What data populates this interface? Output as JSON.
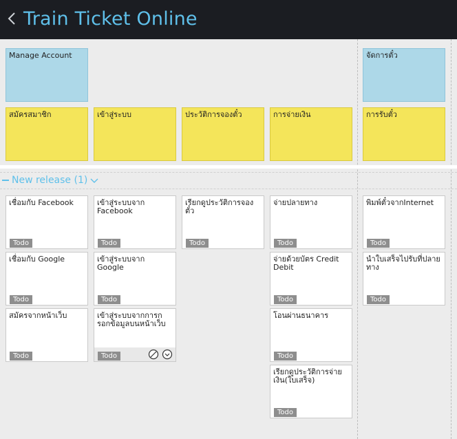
{
  "header": {
    "title": "Train Ticket Online"
  },
  "activities": [
    {
      "label": "Manage Account"
    },
    {
      "label": "จัดการตั๋ว"
    }
  ],
  "features": [
    {
      "label": "สมัครสมาชิก"
    },
    {
      "label": "เข้าสู่ระบบ"
    },
    {
      "label": "ประวัติการจองตั๋ว"
    },
    {
      "label": "การจ่ายเงิน"
    },
    {
      "label": "การรับตั๋ว"
    }
  ],
  "release": {
    "label": "New release (1)"
  },
  "tasks": [
    {
      "text": "เชื่อมกับ Facebook",
      "status": "Todo"
    },
    {
      "text": "เชื่อมกับ Google",
      "status": "Todo"
    },
    {
      "text": "สมัครจากหน้าเว็บ",
      "status": "Todo"
    },
    {
      "text": "เข้าสู่ระบบจาก Facebook",
      "status": "Todo"
    },
    {
      "text": "เข้าสู่ระบบจาก Google",
      "status": "Todo"
    },
    {
      "text": "เข้าสู่ระบบจากการกรอกข้อมูลบนหน้าเว็บ",
      "status": "Todo"
    },
    {
      "text": "เรียกดูประวัติการจองตั๋ว",
      "status": "Todo"
    },
    {
      "text": "จ่ายปลายทาง",
      "status": "Todo"
    },
    {
      "text": "จ่ายด้วยบัตร Credit Debit",
      "status": "Todo"
    },
    {
      "text": "โอนผ่านธนาคาร",
      "status": "Todo"
    },
    {
      "text": "เรียกดูประวัติการจ่ายเงิน(ใบเสร็จ)",
      "status": "Todo"
    },
    {
      "text": "พิมพ์ตั๋วจากInternet",
      "status": "Todo"
    },
    {
      "text": "นำใบเสร็จไปรับที่ปลายทาง",
      "status": "Todo"
    }
  ]
}
